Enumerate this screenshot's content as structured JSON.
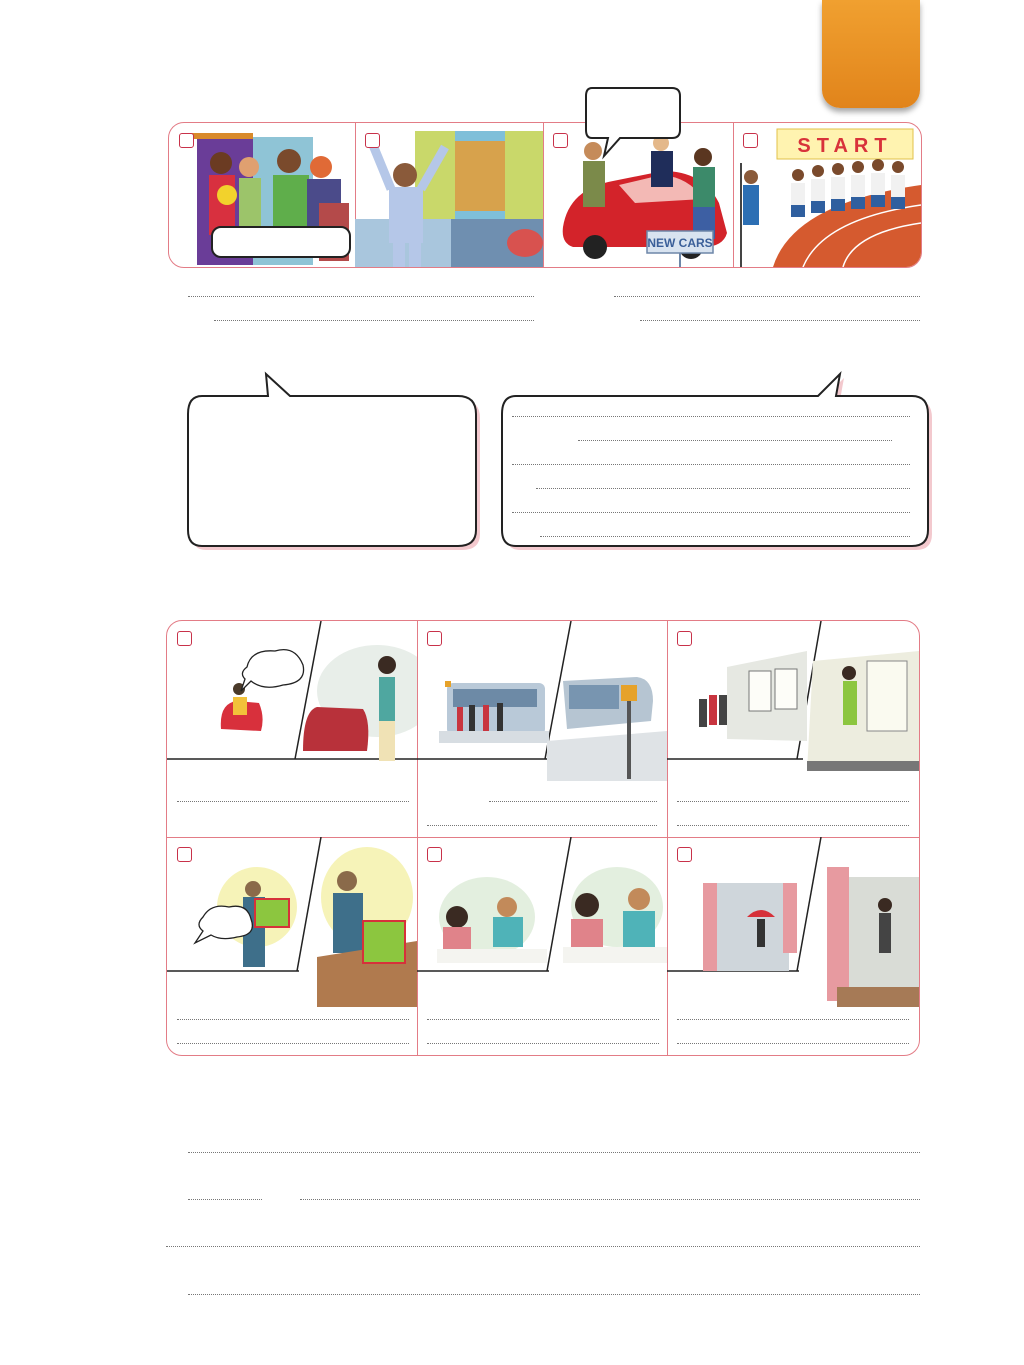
{
  "colors": {
    "accent_tab": "#e68a22",
    "frame_border": "#e37c86",
    "checkbox": "#c8324a",
    "bubble_shadow": "#f3c9ce"
  },
  "top_strip": {
    "panels": [
      {
        "scene": "party-at-door"
      },
      {
        "scene": "man-waking-up"
      },
      {
        "scene": "car-showroom",
        "sign_text": "NEW CARS"
      },
      {
        "scene": "race-start",
        "banner_text": "START"
      }
    ]
  },
  "bottom_grid": {
    "panels": [
      {
        "scene": "woman-reading-in-armchair"
      },
      {
        "scene": "people-waiting-for-bus"
      },
      {
        "scene": "people-boarding-train"
      },
      {
        "scene": "man-carrying-present"
      },
      {
        "scene": "couple-eating-dinner"
      },
      {
        "scene": "rain-outside-window"
      }
    ]
  }
}
